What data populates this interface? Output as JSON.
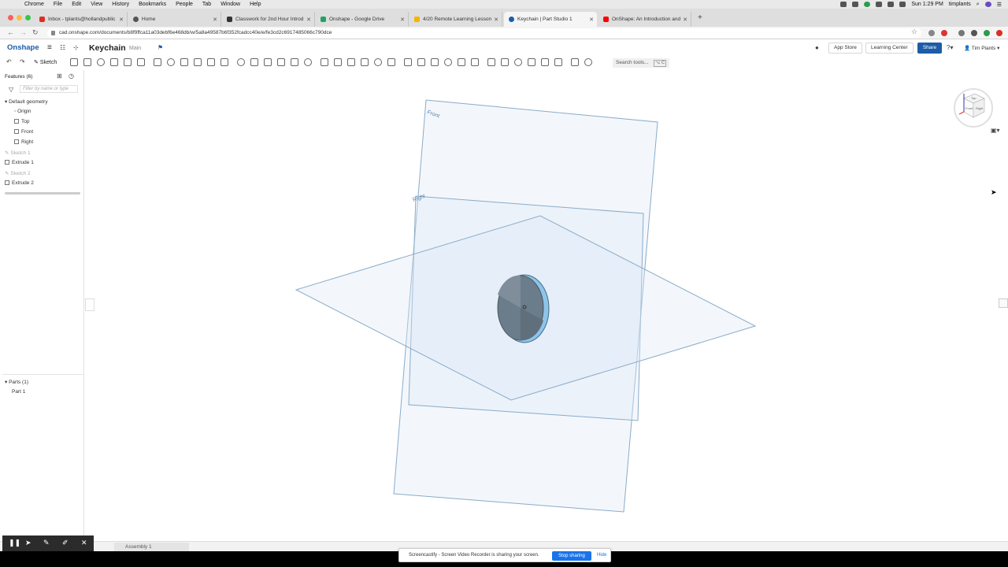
{
  "macbar": {
    "menus": [
      "Chrome",
      "File",
      "Edit",
      "View",
      "History",
      "Bookmarks",
      "People",
      "Tab",
      "Window",
      "Help"
    ],
    "clock": "Sun 1:29 PM",
    "user": "timplants"
  },
  "tabs": [
    {
      "title": "Inbox - tplants@hollandpublic",
      "color": "#d93025"
    },
    {
      "title": "Home",
      "color": "#555555"
    },
    {
      "title": "Classwork for 2nd Hour Introd",
      "color": "#333333"
    },
    {
      "title": "Onshape - Google Drive",
      "color": "#1fa463"
    },
    {
      "title": "4/20 Remote Learning Lesson",
      "color": "#f4b400"
    },
    {
      "title": "Keychain | Part Studio 1",
      "color": "#1c5ca8"
    },
    {
      "title": "OnShape: An Introduction and",
      "color": "#ff0000"
    }
  ],
  "address": {
    "url": "cad.onshape.com/documents/b8f9ffca11a03debf6e468db/w/5a8a49587b6f352fcadcc40e/e/fe3cd2c6917485066c790dce"
  },
  "header": {
    "logo": "Onshape",
    "doc_title": "Keychain",
    "branch": "Main",
    "app_store": "App Store",
    "learning_center": "Learning Center",
    "share": "Share",
    "user": "Tim Plants"
  },
  "toolbar": {
    "sketch": "Sketch",
    "search_placeholder": "Search tools...",
    "search_shortcut": "⌥ C"
  },
  "features": {
    "header": "Features (6)",
    "filter_placeholder": "Filter by name or type",
    "default_geometry": "Default geometry",
    "items": [
      {
        "label": "Origin"
      },
      {
        "label": "Top"
      },
      {
        "label": "Front"
      },
      {
        "label": "Right"
      },
      {
        "label": "Sketch 1"
      },
      {
        "label": "Extrude 1"
      },
      {
        "label": "Sketch 2"
      },
      {
        "label": "Extrude 2"
      }
    ]
  },
  "parts": {
    "header": "Parts (1)",
    "items": [
      "Part 1"
    ]
  },
  "viewport": {
    "plane_labels": [
      "Front",
      "Right"
    ],
    "viewcube_faces": [
      "Front",
      "Right",
      "Top"
    ]
  },
  "bottom": {
    "assembly_tab": "Assembly 1"
  },
  "share_notice": {
    "message": "Screencastify - Screen Video Recorder is sharing your screen.",
    "stop": "Stop sharing",
    "hide": "Hide"
  },
  "colors": {
    "brand": "#1c5ca8",
    "plane_fill": "#dce9f5",
    "plane_stroke": "#8aabc8",
    "part_face": "#6b7c8a",
    "part_rim": "#8fc4e8"
  }
}
